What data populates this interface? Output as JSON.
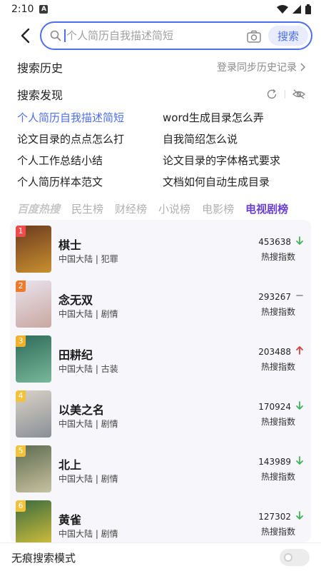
{
  "status_bar": {
    "time": "2:10",
    "notif_letter": "A"
  },
  "search": {
    "placeholder": "个人简历自我描述简短",
    "button_label": "搜索"
  },
  "history": {
    "title": "搜索历史",
    "sync_link": "登录同步历史记录"
  },
  "discover": {
    "title": "搜索发现",
    "items": [
      {
        "text": "个人简历自我描述简短",
        "highlight": true
      },
      {
        "text": "word生成目录怎么弄",
        "highlight": false
      },
      {
        "text": "论文目录的点点怎么打",
        "highlight": false
      },
      {
        "text": "自我简绍怎么说",
        "highlight": false
      },
      {
        "text": "个人工作总结小结",
        "highlight": false
      },
      {
        "text": "论文目录的字体格式要求",
        "highlight": false
      },
      {
        "text": "个人简历样本范文",
        "highlight": false
      },
      {
        "text": "文档如何自动生成目录",
        "highlight": false
      }
    ]
  },
  "tabs": [
    "百度热搜",
    "民生榜",
    "财经榜",
    "小说榜",
    "电影榜",
    "电视剧榜"
  ],
  "active_tab": "电视剧榜",
  "ranking": [
    {
      "rank": "1",
      "title": "棋士",
      "tags": "中国大陆 | 犯罪",
      "score": "453638",
      "trend": "down",
      "label": "热搜指数",
      "badge_color": "#f04a4a",
      "poster": [
        "#6b3a1f",
        "#c9902f"
      ]
    },
    {
      "rank": "2",
      "title": "念无双",
      "tags": "中国大陆 | 剧情",
      "score": "293267",
      "trend": "flat",
      "label": "热搜指数",
      "badge_color": "#f07a2a",
      "poster": [
        "#e9e4ee",
        "#c9a7a0"
      ]
    },
    {
      "rank": "3",
      "title": "田耕纪",
      "tags": "中国大陆 | 古装",
      "score": "203488",
      "trend": "up",
      "label": "热搜指数",
      "badge_color": "#f3b12a",
      "poster": [
        "#2f6b5a",
        "#78b89a"
      ]
    },
    {
      "rank": "4",
      "title": "以美之名",
      "tags": "中国大陆 | 剧情",
      "score": "170924",
      "trend": "down",
      "label": "热搜指数",
      "badge_color": "#f3c23a",
      "poster": [
        "#d9d3c7",
        "#8a8f96"
      ]
    },
    {
      "rank": "5",
      "title": "北上",
      "tags": "中国大陆 | 剧情",
      "score": "143989",
      "trend": "down",
      "label": "热搜指数",
      "badge_color": "#f3c23a",
      "poster": [
        "#5d6b4f",
        "#c8c2a0"
      ]
    },
    {
      "rank": "6",
      "title": "黄雀",
      "tags": "中国大陆 | 剧情",
      "score": "127302",
      "trend": "down",
      "label": "热搜指数",
      "badge_color": "#f3c23a",
      "poster": [
        "#3a6b3f",
        "#d8c23a"
      ]
    }
  ],
  "bottom": {
    "label": "无痕搜索模式",
    "toggle_on": false
  },
  "colors": {
    "accent": "#4e6ef2",
    "active_tab": "#6b3fd1",
    "trend_up": "#e23b3b",
    "trend_down": "#3cb55a",
    "trend_flat": "#999999"
  }
}
